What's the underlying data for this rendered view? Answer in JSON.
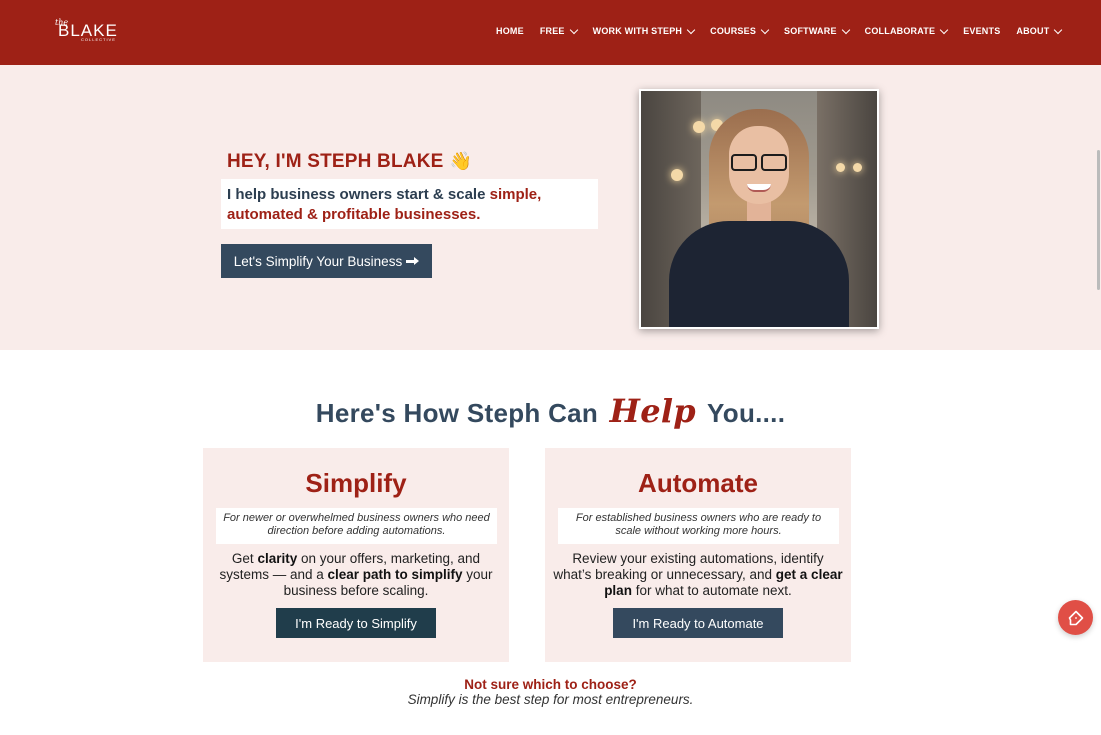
{
  "header": {
    "logo": {
      "the": "the",
      "name": "BLAKE",
      "sub": "COLLECTIVE"
    },
    "nav": [
      {
        "label": "HOME",
        "dropdown": false
      },
      {
        "label": "FREE",
        "dropdown": true
      },
      {
        "label": "WORK WITH STEPH",
        "dropdown": true
      },
      {
        "label": "COURSES",
        "dropdown": true
      },
      {
        "label": "SOFTWARE",
        "dropdown": true
      },
      {
        "label": "COLLABORATE",
        "dropdown": true
      },
      {
        "label": "EVENTS",
        "dropdown": false
      },
      {
        "label": "ABOUT",
        "dropdown": true
      }
    ]
  },
  "hero": {
    "title": "HEY, I'M STEPH BLAKE",
    "wave_emoji": "👋",
    "subtitle_plain": "I help business owners start & scale ",
    "subtitle_highlight": "simple, automated & profitable businesses.",
    "cta_label": "Let's Simplify Your Business",
    "photo_icon": "portrait-photo"
  },
  "section": {
    "title_before": "Here's How Steph Can",
    "title_script": "Help",
    "title_after": "You...."
  },
  "cards": {
    "simplify": {
      "title": "Simplify",
      "note": "For newer or overwhelmed business owners who need direction before adding automations.",
      "body_1": "Get ",
      "body_bold_1": "clarity",
      "body_2": " on your offers, marketing, and systems — and a ",
      "body_bold_2": "clear path to simplify",
      "body_3": " your business before scaling.",
      "button": "I'm Ready to Simplify"
    },
    "automate": {
      "title": "Automate",
      "note": "For established business owners who are ready to scale without working more hours.",
      "body_1": "Review your existing automations, identify what’s breaking or unnecessary, and ",
      "body_bold_1": "get a clear plan",
      "body_2": " for what to automate next.",
      "button": "I'm Ready to Automate"
    }
  },
  "footer_note": {
    "question": "Not sure which to choose?",
    "answer": "Simplify is the best step for most entrepreneurs."
  },
  "colors": {
    "brand_red": "#9e2116",
    "navy": "#34495e",
    "dark_teal": "#203d4b",
    "pink_bg": "#f9ecea",
    "chat_red": "#e04f46"
  },
  "icons": {
    "chat": "chat-bubble-icon",
    "arrow": "arrow-right-icon",
    "chevron": "chevron-down-icon"
  }
}
